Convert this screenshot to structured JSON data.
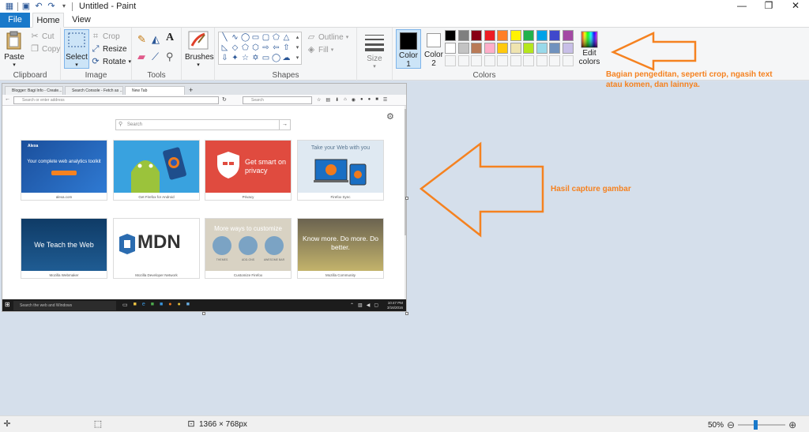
{
  "window": {
    "title": "Untitled - Paint",
    "minimize_icon": "minimize-icon",
    "maximize_icon": "restore-icon",
    "close_icon": "close-icon"
  },
  "tabs": {
    "file": "File",
    "home": "Home",
    "view": "View"
  },
  "ribbon": {
    "clipboard": {
      "label": "Clipboard",
      "paste": "Paste",
      "cut": "Cut",
      "copy": "Copy"
    },
    "image": {
      "label": "Image",
      "select": "Select",
      "crop": "Crop",
      "resize": "Resize",
      "rotate": "Rotate"
    },
    "tools": {
      "label": "Tools"
    },
    "brushes": {
      "label": "Brushes"
    },
    "shapes": {
      "label": "Shapes",
      "outline": "Outline",
      "fill": "Fill"
    },
    "size": {
      "label": "Size"
    },
    "colors": {
      "label": "Colors",
      "color1_label": "Color",
      "color1_num": "1",
      "color2_label": "Color",
      "color2_num": "2",
      "edit_label": "Edit",
      "edit_label2": "colors",
      "color1_value": "#000000",
      "color2_value": "#ffffff",
      "palette_row1": [
        "#000000",
        "#7f7f7f",
        "#880015",
        "#ed1c24",
        "#ff7f27",
        "#fff200",
        "#22b14c",
        "#00a2e8",
        "#3f48cc",
        "#a349a4"
      ],
      "palette_row2": [
        "#ffffff",
        "#c3c3c3",
        "#b97a57",
        "#ffaec9",
        "#ffc90e",
        "#efe4b0",
        "#b5e61d",
        "#99d9ea",
        "#7092be",
        "#c8bfe7"
      ]
    }
  },
  "capture": {
    "browser_tabs": [
      "Blogger: Bagi Info - Create...",
      "Search Console - Fetch as ...",
      "New Tab"
    ],
    "url_placeholder": "Search or enter address",
    "search_placeholder": "Search",
    "newtab_search": "Search",
    "tiles": [
      {
        "title": "Alexa",
        "headline": "Your complete web analytics toolkit",
        "caption": "alexa.com"
      },
      {
        "title": "",
        "headline": "",
        "caption": "Get Firefox for Android"
      },
      {
        "title": "",
        "headline": "Get smart on privacy",
        "caption": "Privacy"
      },
      {
        "title": "",
        "headline": "Take your Web with you",
        "caption": "Firefox Sync"
      },
      {
        "title": "",
        "headline": "We Teach the Web",
        "caption": "Mozilla Webmaker"
      },
      {
        "title": "",
        "headline": "MDN",
        "caption": "Mozilla Developer Network"
      },
      {
        "title": "",
        "headline": "More ways to customize",
        "caption": "Customize Firefox",
        "badges": [
          "THEMES",
          "ADD-ONS",
          "AWESOME BAR"
        ]
      },
      {
        "title": "",
        "headline": "Know more. Do more. Do better.",
        "caption": "Mozilla Community"
      }
    ],
    "taskbar_search": "Search the web and Windows",
    "clock_time": "10:47 PM",
    "clock_date": "3/16/2016"
  },
  "annotations": {
    "top": "Bagian pengeditan, seperti crop, ngasih text atau komen, dan lainnya.",
    "middle": "Hasil capture gambar"
  },
  "statusbar": {
    "dimensions": "1366 × 768px",
    "zoom": "50%"
  }
}
